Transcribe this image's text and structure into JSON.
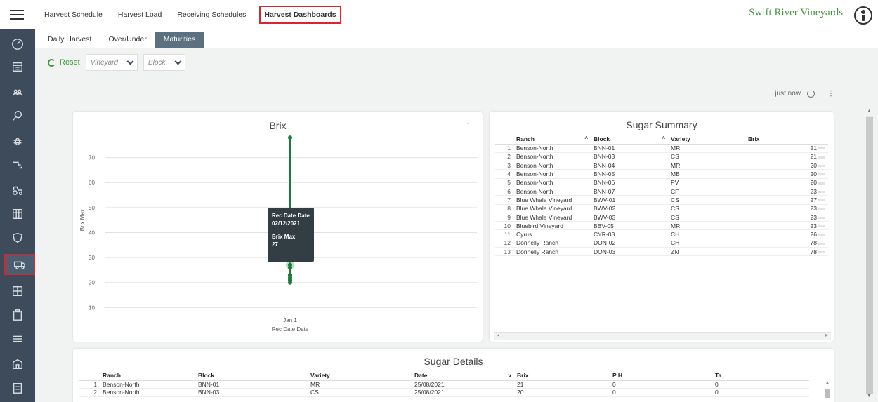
{
  "topnav": {
    "items": [
      "Harvest Schedule",
      "Harvest Load",
      "Receiving Schedules",
      "Harvest Dashboards"
    ],
    "brand": "Swift River Vineyards"
  },
  "subtabs": [
    "Daily Harvest",
    "Over/Under",
    "Maturities"
  ],
  "filters": {
    "reset_label": "Reset",
    "vineyard_placeholder": "Vineyard",
    "block_placeholder": "Block"
  },
  "refresh": {
    "updated": "just now"
  },
  "brix_chart": {
    "title": "Brix",
    "tooltip": {
      "label1": "Rec Date Date",
      "value1": "02/12/2021",
      "label2": "Brix Max",
      "value2": "27"
    }
  },
  "chart_data": {
    "type": "scatter",
    "title": "Brix",
    "xlabel": "Rec Date Date",
    "ylabel": "Brix Max",
    "x_ticks": [
      "Jan 1"
    ],
    "y_ticks": [
      10,
      20,
      30,
      40,
      50,
      60,
      70
    ],
    "ylim": [
      7,
      80
    ],
    "grid": true,
    "range": {
      "min": 20,
      "max": 78
    },
    "points": [
      20,
      21,
      21,
      22,
      23,
      23,
      23,
      26,
      27,
      78
    ]
  },
  "summary": {
    "title": "Sugar Summary",
    "columns": [
      "Ranch",
      "Block",
      "Variety",
      "Brix"
    ],
    "rows": [
      [
        "1",
        "Benson-North",
        "BNN-01",
        "MR",
        "21"
      ],
      [
        "2",
        "Benson-North",
        "BNN-03",
        "CS",
        "21"
      ],
      [
        "3",
        "Benson-North",
        "BNN-04",
        "MR",
        "20"
      ],
      [
        "4",
        "Benson-North",
        "BNN-05",
        "MB",
        "20"
      ],
      [
        "5",
        "Benson-North",
        "BNN-06",
        "PV",
        "20"
      ],
      [
        "6",
        "Benson-North",
        "BNN-07",
        "CF",
        "23"
      ],
      [
        "7",
        "Blue Whale Vineyard",
        "BWV-01",
        "CS",
        "27"
      ],
      [
        "8",
        "Blue Whale Vineyard",
        "BWV-02",
        "CS",
        "23"
      ],
      [
        "9",
        "Blue Whale Vineyard",
        "BWV-03",
        "CS",
        "23"
      ],
      [
        "10",
        "Bluebird Vineyard",
        "BBV-05",
        "MR",
        "23"
      ],
      [
        "11",
        "Cyrus",
        "CYR-03",
        "CH",
        "26"
      ],
      [
        "12",
        "Donnelly Ranch",
        "DON-02",
        "CH",
        "78"
      ],
      [
        "13",
        "Donnelly Ranch",
        "DON-03",
        "ZN",
        "78"
      ]
    ]
  },
  "details": {
    "title": "Sugar Details",
    "columns": [
      "Ranch",
      "Block",
      "Variety",
      "Date",
      "Brix",
      "P H",
      "Ta"
    ],
    "rows": [
      [
        "1",
        "Benson-North",
        "BNN-01",
        "MR",
        "25/08/2021",
        "21",
        "0",
        "0"
      ],
      [
        "2",
        "Benson-North",
        "BNN-03",
        "CS",
        "25/08/2021",
        "20",
        "0",
        "0"
      ]
    ]
  },
  "colors": {
    "accent": "#3e9a3b",
    "sidebar": "#3d4b5b",
    "highlight": "#d9262e",
    "series": "#1e7a3a"
  }
}
